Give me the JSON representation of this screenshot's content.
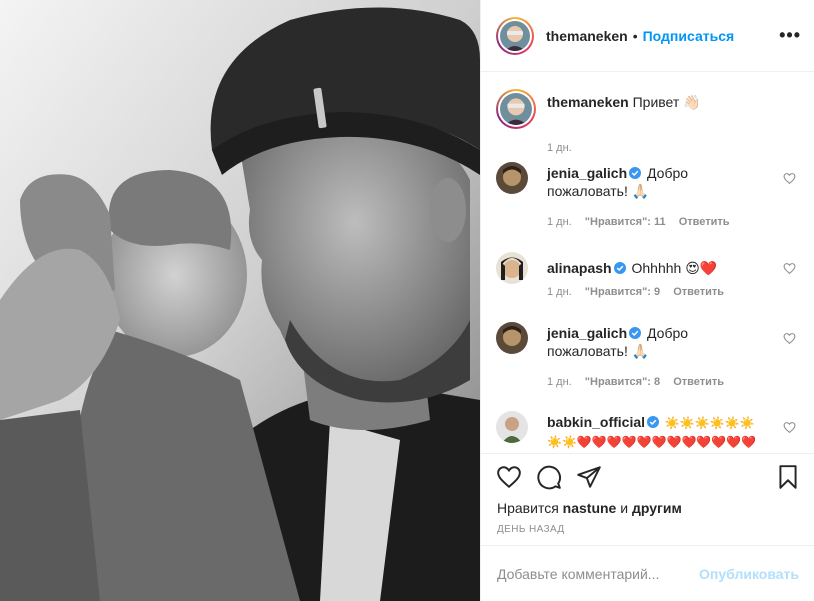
{
  "post": {
    "username": "themaneken",
    "separator": "•",
    "follow_label": "Подписаться",
    "more_icon": "more-horizontal-icon",
    "more_label": "•••"
  },
  "caption": {
    "username": "themaneken",
    "text": "Привет 👋🏻",
    "time": "1 дн."
  },
  "comments": [
    {
      "username": "jenia_galich",
      "verified": true,
      "text": "Добро пожаловать! 🙏🏻",
      "time": "1 дн.",
      "likes": "\"Нравится\": 11",
      "reply": "Ответить"
    },
    {
      "username": "alinapash",
      "verified": true,
      "text": "Ohhhhh 😍❤️",
      "time": "1 дн.",
      "likes": "\"Нравится\": 9",
      "reply": "Ответить"
    },
    {
      "username": "jenia_galich",
      "verified": true,
      "text": "Добро пожаловать! 🙏🏻",
      "time": "1 дн.",
      "likes": "\"Нравится\": 8",
      "reply": "Ответить"
    },
    {
      "username": "babkin_official",
      "verified": true,
      "text": "☀️☀️☀️☀️☀️☀️☀️☀️❤️❤️❤️❤️❤️❤️❤️❤️❤️❤️❤️❤️☀️☀️☀️СБ",
      "time": "",
      "likes": "",
      "reply": ""
    }
  ],
  "actions": {
    "like_icon": "heart-icon",
    "comment_icon": "comment-icon",
    "share_icon": "share-icon",
    "save_icon": "bookmark-icon",
    "likes_prefix": "Нравится",
    "likes_user": "nastune",
    "likes_and": "и",
    "likes_others": "другим",
    "date": "ДЕНЬ НАЗАД"
  },
  "add_comment": {
    "placeholder": "Добавьте комментарий...",
    "publish_label": "Опубликовать"
  },
  "colors": {
    "accent": "#0095f6",
    "publish_disabled": "#b2dffc",
    "verified": "#3897f0",
    "muted": "#8e8e8e"
  }
}
